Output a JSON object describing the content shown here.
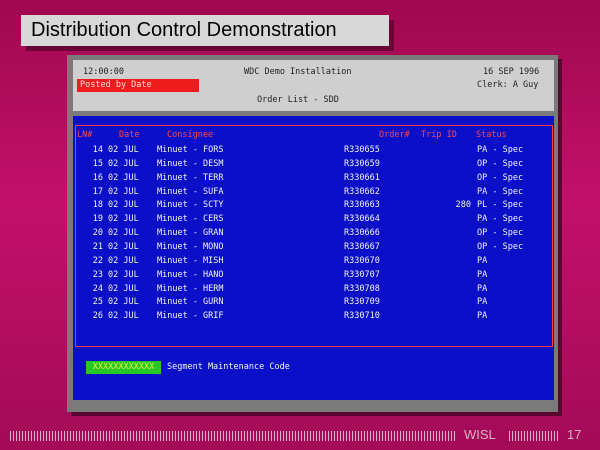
{
  "slide": {
    "title": "Distribution Control Demonstration",
    "footer_org": "WISL",
    "page_number": "17"
  },
  "header": {
    "time": "12:00:00",
    "app_title": "WDC Demo Installation",
    "date": "16 SEP 1996",
    "status": "Posted by Date",
    "clerk": "Clerk: A Guy",
    "screen_title": "Order List - SDD"
  },
  "columns": {
    "line": "LN#",
    "date": "Date",
    "consignee": "Consignee",
    "order": "Order#",
    "trip": "Trip ID",
    "status": "Status"
  },
  "rows": [
    {
      "ln": "14",
      "date": "02 JUL",
      "consignee": "Minuet - FORS",
      "order": "R330655",
      "trip": "",
      "status": "PA - Spec"
    },
    {
      "ln": "15",
      "date": "02 JUL",
      "consignee": "Minuet - DESM",
      "order": "R330659",
      "trip": "",
      "status": "OP - Spec"
    },
    {
      "ln": "16",
      "date": "02 JUL",
      "consignee": "Minuet - TERR",
      "order": "R330661",
      "trip": "",
      "status": "OP - Spec"
    },
    {
      "ln": "17",
      "date": "02 JUL",
      "consignee": "Minuet - SUFA",
      "order": "R330662",
      "trip": "",
      "status": "PA - Spec"
    },
    {
      "ln": "18",
      "date": "02 JUL",
      "consignee": "Minuet - SCTY",
      "order": "R330663",
      "trip": "280",
      "status": "PL - Spec"
    },
    {
      "ln": "19",
      "date": "02 JUL",
      "consignee": "Minuet - CERS",
      "order": "R330664",
      "trip": "",
      "status": "PA - Spec"
    },
    {
      "ln": "20",
      "date": "02 JUL",
      "consignee": "Minuet - GRAN",
      "order": "R330666",
      "trip": "",
      "status": "OP - Spec"
    },
    {
      "ln": "21",
      "date": "02 JUL",
      "consignee": "Minuet - MONO",
      "order": "R330667",
      "trip": "",
      "status": "OP - Spec"
    },
    {
      "ln": "22",
      "date": "02 JUL",
      "consignee": "Minuet - MISH",
      "order": "R330670",
      "trip": "",
      "status": "PA"
    },
    {
      "ln": "23",
      "date": "02 JUL",
      "consignee": "Minuet - HANO",
      "order": "R330707",
      "trip": "",
      "status": "PA"
    },
    {
      "ln": "24",
      "date": "02 JUL",
      "consignee": "Minuet - HERM",
      "order": "R330708",
      "trip": "",
      "status": "PA"
    },
    {
      "ln": "25",
      "date": "02 JUL",
      "consignee": "Minuet - GURN",
      "order": "R330709",
      "trip": "",
      "status": "PA"
    },
    {
      "ln": "26",
      "date": "02 JUL",
      "consignee": "Minuet - GRIF",
      "order": "R330710",
      "trip": "",
      "status": "PA"
    }
  ],
  "segment": {
    "code_value": "XXXXXXXXXXXX",
    "label": "Segment Maintenance Code"
  },
  "colors": {
    "background": "#b00c60",
    "terminal_blue": "#0b10c8",
    "header_red": "#ff4646",
    "status_red": "#ee1c1c",
    "field_green": "#25c825"
  }
}
